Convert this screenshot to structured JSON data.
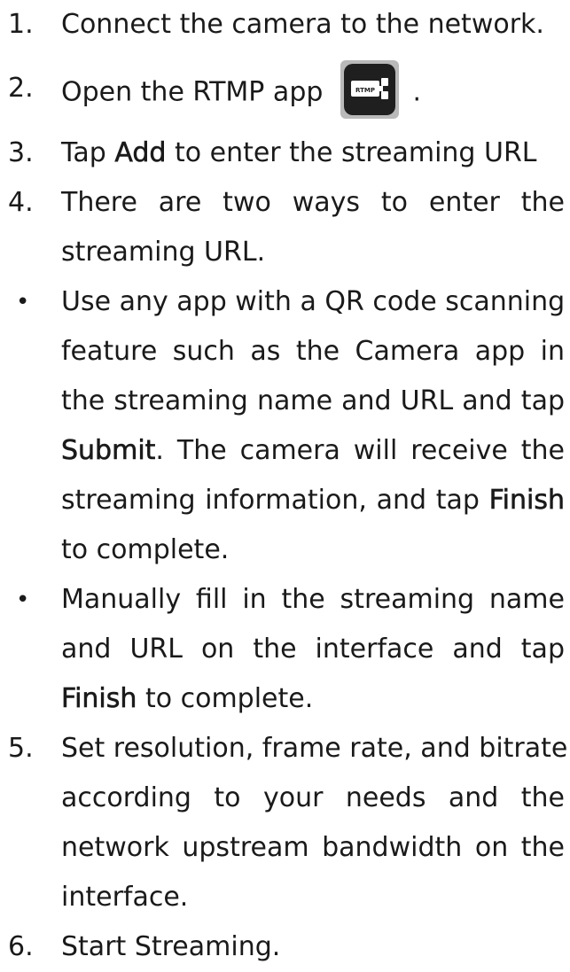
{
  "steps": [
    {
      "marker": "1.",
      "text": "Connect the camera to the network."
    },
    {
      "marker": "2.",
      "text_before": "Open the RTMP app",
      "icon_label": "RTMP",
      "text_after": "."
    },
    {
      "marker": "3.",
      "text_before": "Tap ",
      "bold": "Add",
      "text_after": " to enter the streaming URL"
    },
    {
      "marker": "4.",
      "lines": [
        "There are two ways to enter the",
        "streaming URL."
      ]
    },
    {
      "marker": "5.",
      "lines": [
        "Set resolution, frame rate, and bitrate",
        "according to your needs and the",
        "network upstream bandwidth on the",
        "interface."
      ]
    },
    {
      "marker": "6.",
      "text": "Start Streaming."
    }
  ],
  "bullets": [
    {
      "marker": "•",
      "line1": "Use any app with a QR code scanning",
      "line2": "feature such as the Camera app in",
      "line3": "the streaming name and URL and tap",
      "line4_bold": "Submit",
      "line4_rest": ". The camera will receive the",
      "line5_before": "streaming information, and tap ",
      "line5_bold": "Finish",
      "line6": "to complete."
    },
    {
      "marker": "•",
      "line1": "Manually fill in the streaming name",
      "line2": "and URL on the interface and tap",
      "line3_bold": "Finish",
      "line3_rest": " to complete."
    }
  ],
  "icon_colors": {
    "background": "#1f1f1f",
    "label_bg": "#ffffff",
    "frame": "#b9b9b9"
  }
}
